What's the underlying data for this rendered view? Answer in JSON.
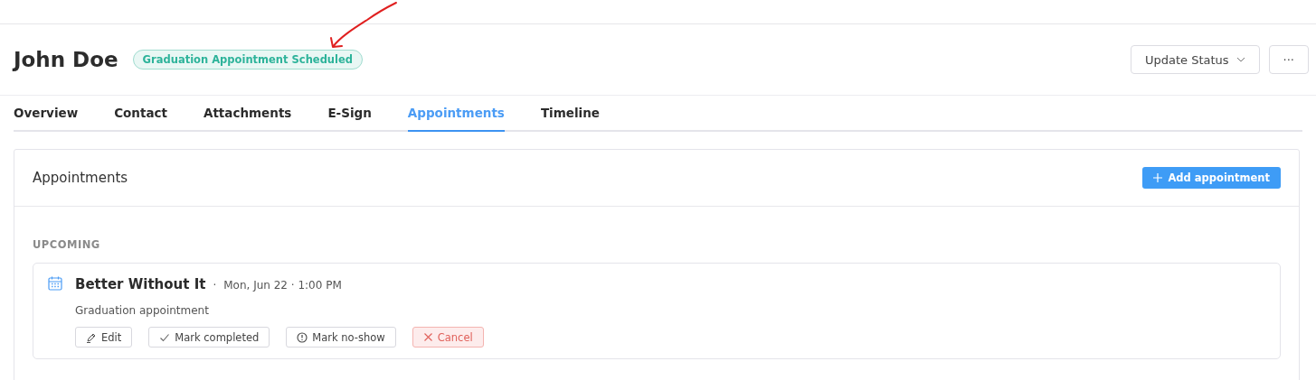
{
  "header": {
    "name": "John Doe",
    "status_badge": "Graduation Appointment Scheduled",
    "buttons": [
      {
        "kind": "dropdown",
        "label": "Update Status"
      },
      {
        "kind": "more",
        "label": "···"
      }
    ]
  },
  "tabs": [
    {
      "label": "Overview",
      "selected": false
    },
    {
      "label": "Contact",
      "selected": false
    },
    {
      "label": "Attachments",
      "selected": false
    },
    {
      "label": "E-Sign",
      "selected": false
    },
    {
      "label": "Appointments",
      "selected": true
    },
    {
      "label": "Timeline",
      "selected": false
    }
  ],
  "panel": {
    "title": "Appointments",
    "add_button": "Add appointment",
    "section": "UPCOMING",
    "appointments": [
      {
        "title": "Better Without It",
        "separator": "·",
        "when": "Mon, Jun 22 · 1:00 PM",
        "description": "Graduation appointment",
        "actions": [
          {
            "kind": "edit",
            "label": "Edit"
          },
          {
            "kind": "complete",
            "label": "Mark completed"
          },
          {
            "kind": "no-show",
            "label": "Mark no-show"
          },
          {
            "kind": "cancel",
            "label": "Cancel"
          }
        ]
      }
    ]
  }
}
